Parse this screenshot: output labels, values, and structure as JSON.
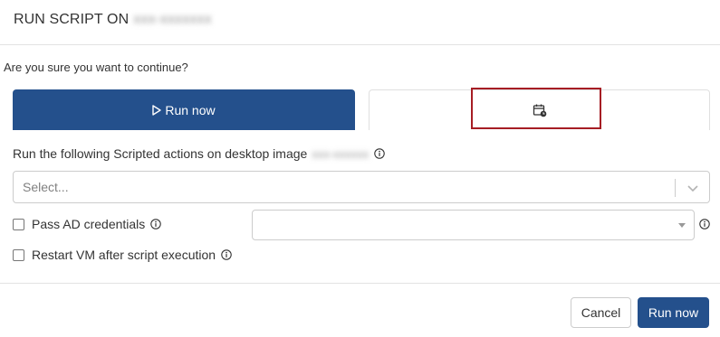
{
  "dialog": {
    "title": "RUN SCRIPT ON",
    "title_target_redacted": "xxx-xxxxxxx",
    "confirm_question": "Are you sure you want to continue?"
  },
  "tabs": {
    "run_now_label": "Run now",
    "schedule_icon": "calendar-clock-icon",
    "active_color": "#24508c",
    "highlight_color": "#a61d24"
  },
  "script_section": {
    "label": "Run the following Scripted actions on desktop image",
    "image_name_redacted": "xxx-xxxxxx",
    "select_placeholder": "Select..."
  },
  "options": {
    "pass_ad_label": "Pass AD credentials",
    "pass_ad_checked": false,
    "credentials_value": "",
    "restart_label": "Restart VM after script execution",
    "restart_checked": false
  },
  "footer": {
    "cancel_label": "Cancel",
    "run_label": "Run now"
  }
}
